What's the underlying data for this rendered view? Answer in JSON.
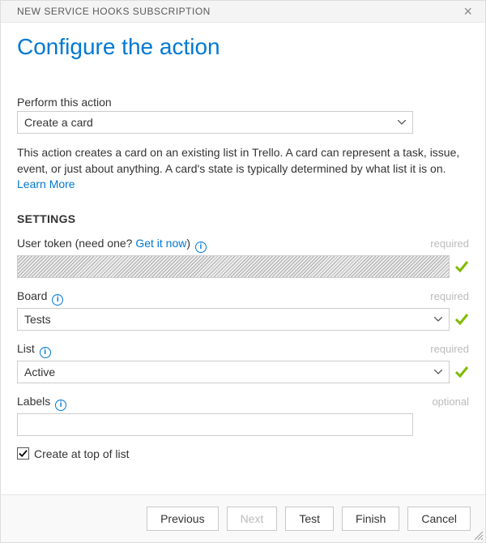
{
  "dialog_title": "NEW SERVICE HOOKS SUBSCRIPTION",
  "title": "Configure the action",
  "action": {
    "label": "Perform this action",
    "selected": "Create a card",
    "description_prefix": "This action creates a card on an existing list in Trello. A card can represent a task, issue, event, or just about anything. A card's state is typically determined by what list it is on. ",
    "learn_more": "Learn More"
  },
  "settings_heading": "SETTINGS",
  "user_token": {
    "label_prefix": "User token (need one? ",
    "get_it_now": "Get it now",
    "label_suffix": ")",
    "hint": "required"
  },
  "board": {
    "label": "Board",
    "hint": "required",
    "selected": "Tests"
  },
  "list": {
    "label": "List",
    "hint": "required",
    "selected": "Active"
  },
  "labels_field": {
    "label": "Labels",
    "hint": "optional",
    "value": ""
  },
  "create_top": {
    "label": "Create at top of list",
    "checked": true
  },
  "buttons": {
    "previous": "Previous",
    "next": "Next",
    "test": "Test",
    "finish": "Finish",
    "cancel": "Cancel"
  }
}
